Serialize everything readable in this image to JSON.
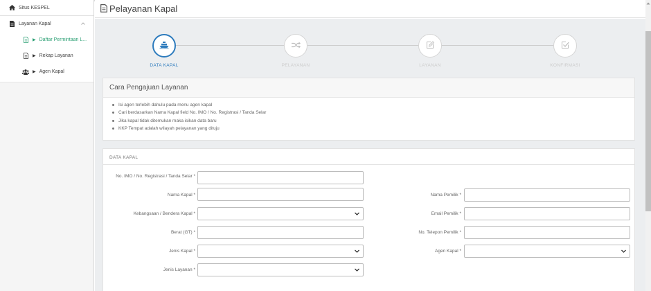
{
  "sidebar": {
    "items": [
      {
        "label": "Situs KESPEL",
        "icon": "home-icon"
      },
      {
        "label": "Layanan Kapal",
        "icon": "file-icon",
        "expanded": true
      }
    ],
    "sub_items": [
      {
        "label": "Daftar Permintaan L...",
        "icon": "document-icon",
        "active": true
      },
      {
        "label": "Rekap Layanan",
        "icon": "document-icon",
        "active": false
      },
      {
        "label": "Agen Kapal",
        "icon": "users-icon",
        "active": false
      }
    ]
  },
  "header": {
    "title": "Pelayanan Kapal",
    "icon": "document-icon"
  },
  "stepper": {
    "steps": [
      {
        "label": "DATA KAPAL",
        "icon": "ship-icon",
        "active": true
      },
      {
        "label": "PELAYANAN",
        "icon": "shuffle-icon",
        "active": false
      },
      {
        "label": "LAYANAN",
        "icon": "edit-icon",
        "active": false
      },
      {
        "label": "KONFIRMASI",
        "icon": "check-square-icon",
        "active": false
      }
    ]
  },
  "info_panel": {
    "title": "Cara Pengajuan Layanan",
    "items": [
      "Isi agen terlebih dahulu pada menu agen kapal",
      "Cari berdasarkan Nama Kapal field No. IMO / No. Registrasi / Tanda Selar",
      "Jika kapal tidak ditemukan maka isikan data baru",
      "KKP Tempat adalah wilayah pelayanan yang dituju"
    ]
  },
  "form": {
    "title": "DATA KAPAL",
    "required_mark": "*",
    "left_fields": [
      {
        "label": "No. IMO / No. Registrasi / Tanda Selar",
        "type": "input",
        "value": ""
      },
      {
        "label": "Nama Kapal",
        "type": "input",
        "value": ""
      },
      {
        "label": "Kebangsaan / Bendera Kapal",
        "type": "select",
        "value": ""
      },
      {
        "label": "Berat (GT)",
        "type": "input",
        "value": ""
      },
      {
        "label": "Jenis Kapal",
        "type": "select",
        "value": ""
      },
      {
        "label": "Jenis Layanan",
        "type": "select",
        "value": ""
      }
    ],
    "right_fields": [
      {
        "label": "Nama Pemilik",
        "type": "input",
        "value": ""
      },
      {
        "label": "Email Pemilik",
        "type": "input",
        "value": ""
      },
      {
        "label": "No. Telepon Pemilik",
        "type": "input",
        "value": ""
      },
      {
        "label": "Agen Kapal",
        "type": "select",
        "value": ""
      }
    ]
  },
  "colors": {
    "accent": "#2d7bbd",
    "sidebar_active": "#2a9f73",
    "background": "#eceef0"
  }
}
